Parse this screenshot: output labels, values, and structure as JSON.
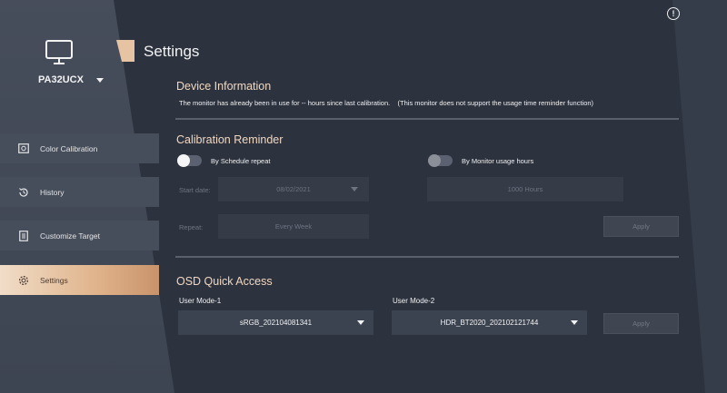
{
  "sidebar": {
    "model": "PA32UCX",
    "items": [
      {
        "label": "Color Calibration",
        "icon": "color-calibration-icon"
      },
      {
        "label": "History",
        "icon": "history-icon"
      },
      {
        "label": "Customize Target",
        "icon": "customize-target-icon"
      },
      {
        "label": "Settings",
        "icon": "gear-icon",
        "active": true
      }
    ]
  },
  "header": {
    "title": "Settings"
  },
  "device_info": {
    "title": "Device Information",
    "text": "The monitor has already been in use for -- hours since last calibration.    (This monitor does not support the usage time reminder function)"
  },
  "reminder": {
    "title": "Calibration Reminder",
    "schedule_label": "By Schedule repeat",
    "usage_label": "By Monitor usage hours",
    "start_date_label": "Start date:",
    "start_date_value": "08/02/2021",
    "hours_value": "1000 Hours",
    "repeat_label": "Repeat:",
    "repeat_value": "Every Week",
    "apply_label": "Apply"
  },
  "osd": {
    "title": "OSD Quick Access",
    "mode1_label": "User Mode-1",
    "mode1_value": "sRGB_202104081341",
    "mode2_label": "User Mode-2",
    "mode2_value": "HDR_BT2020_202102121744",
    "apply_label": "Apply"
  },
  "colors": {
    "accent": "#e0b48c",
    "section_title": "#f1d8c2"
  }
}
